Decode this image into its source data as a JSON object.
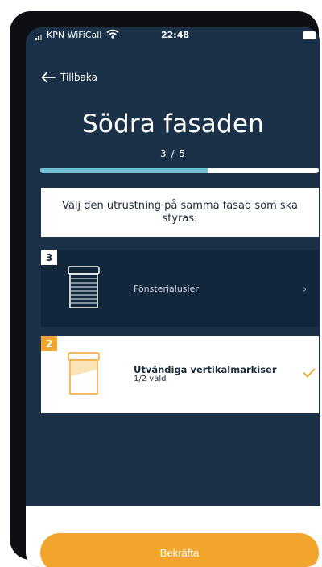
{
  "status_bar": {
    "carrier": "KPN WiFiCall",
    "time": "22:48"
  },
  "nav": {
    "back_label": "Tillbaka",
    "back_icon": "arrow-left-icon"
  },
  "header": {
    "title": "Södra fasaden",
    "step": "3 / 5"
  },
  "progress": {
    "fraction": 0.6,
    "color": "#6dbecf"
  },
  "instruction": "Välj den utrustning på samma fasad som ska styras:",
  "equipment": [
    {
      "badge": "3",
      "label": "Fönsterjalusier",
      "subtitle": "",
      "icon": "venetian-blind-icon",
      "selected": false
    },
    {
      "badge": "2",
      "label": "Utvändiga vertikalmarkiser",
      "subtitle": "1/2 vald",
      "icon": "vertical-awning-icon",
      "selected": true
    }
  ],
  "footer": {
    "confirm_label": "Bekräfta"
  },
  "colors": {
    "background": "#1b3148",
    "accent": "#f2a52d",
    "card_dark": "#12273b"
  }
}
